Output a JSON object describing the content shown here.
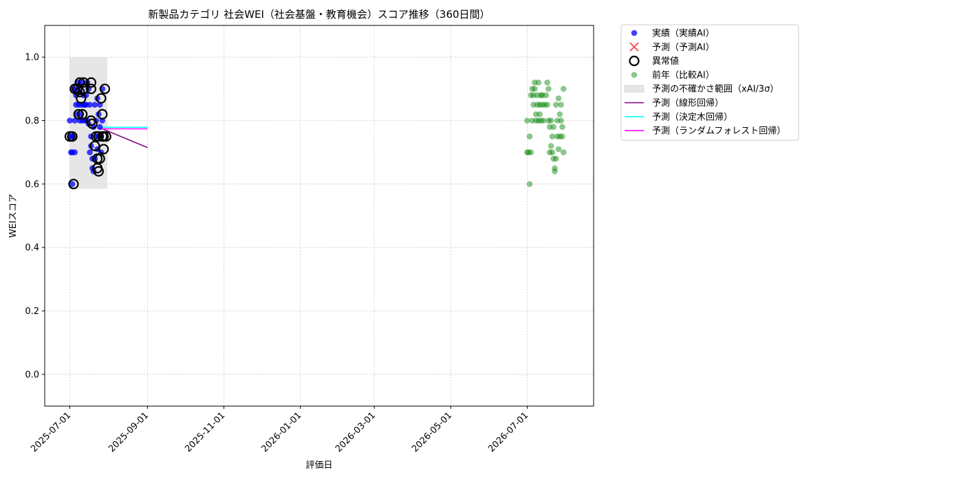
{
  "chart_data": {
    "type": "scatter",
    "title": "新製品カテゴリ 社会WEI（社会基盤・教育機会）スコア推移（360日間）",
    "xlabel": "評価日",
    "ylabel": "WEIスコア",
    "x_ticks": [
      "2025-07-01",
      "2025-09-01",
      "2025-11-01",
      "2026-01-01",
      "2026-03-01",
      "2026-05-01",
      "2026-07-01"
    ],
    "xlim": [
      "2025-06-11",
      "2026-08-23"
    ],
    "y_ticks": [
      "0.0",
      "0.2",
      "0.4",
      "0.6",
      "0.8",
      "1.0"
    ],
    "ylim": [
      -0.1,
      1.1
    ],
    "grid": true,
    "legend_placement": "outside-right-top",
    "colors": {
      "actual": "#0000ff",
      "forecast": "#ff0000",
      "anomaly": "#000000",
      "previous_year": "#008000",
      "uncertainty": "#e5e5e5",
      "linear": "#800080",
      "tree": "#00ffff",
      "forest": "#ff00ff"
    },
    "legend": [
      {
        "key": "actual",
        "label": "実績（実績AI）",
        "marker": "dot"
      },
      {
        "key": "forecast",
        "label": "予測（予測AI）",
        "marker": "cross"
      },
      {
        "key": "anomaly",
        "label": "異常値",
        "marker": "ring"
      },
      {
        "key": "previous_year",
        "label": "前年（比較AI）",
        "marker": "dot-faded"
      },
      {
        "key": "uncertainty",
        "label": "予測の不確かさ範囲（xAI/3σ）",
        "marker": "patch"
      },
      {
        "key": "linear",
        "label": "予測（線形回帰）",
        "marker": "line"
      },
      {
        "key": "tree",
        "label": "予測（決定木回帰）",
        "marker": "line"
      },
      {
        "key": "forest",
        "label": "予測（ランダムフォレスト回帰）",
        "marker": "line"
      }
    ],
    "uncertainty_band": {
      "x": [
        "2025-07-01",
        "2025-07-31"
      ],
      "y": [
        0.585,
        1.0
      ]
    },
    "series": [
      {
        "key": "actual",
        "type": "scatter",
        "points": [
          [
            "2025-07-01",
            0.8
          ],
          [
            "2025-07-01",
            0.75
          ],
          [
            "2025-07-02",
            0.7
          ],
          [
            "2025-07-02",
            0.75
          ],
          [
            "2025-07-03",
            0.6
          ],
          [
            "2025-07-03",
            0.7
          ],
          [
            "2025-07-04",
            0.75
          ],
          [
            "2025-07-04",
            0.9
          ],
          [
            "2025-07-05",
            0.7
          ],
          [
            "2025-07-05",
            0.8
          ],
          [
            "2025-07-06",
            0.85
          ],
          [
            "2025-07-06",
            0.88
          ],
          [
            "2025-07-07",
            0.9
          ],
          [
            "2025-07-07",
            0.82
          ],
          [
            "2025-07-08",
            0.85
          ],
          [
            "2025-07-08",
            0.92
          ],
          [
            "2025-07-09",
            0.8
          ],
          [
            "2025-07-09",
            0.89
          ],
          [
            "2025-07-10",
            0.85
          ],
          [
            "2025-07-10",
            0.82
          ],
          [
            "2025-07-11",
            0.8
          ],
          [
            "2025-07-11",
            0.92
          ],
          [
            "2025-07-12",
            0.85
          ],
          [
            "2025-07-12",
            0.88
          ],
          [
            "2025-07-13",
            0.8
          ],
          [
            "2025-07-13",
            0.85
          ],
          [
            "2025-07-14",
            0.88
          ],
          [
            "2025-07-14",
            0.85
          ],
          [
            "2025-07-15",
            0.92
          ],
          [
            "2025-07-15",
            0.8
          ],
          [
            "2025-07-16",
            0.79
          ],
          [
            "2025-07-16",
            0.9
          ],
          [
            "2025-07-17",
            0.85
          ],
          [
            "2025-07-17",
            0.7
          ],
          [
            "2025-07-18",
            0.72
          ],
          [
            "2025-07-18",
            0.75
          ],
          [
            "2025-07-19",
            0.68
          ],
          [
            "2025-07-19",
            0.65
          ],
          [
            "2025-07-20",
            0.78
          ],
          [
            "2025-07-20",
            0.64
          ],
          [
            "2025-07-21",
            0.68
          ],
          [
            "2025-07-21",
            0.85
          ],
          [
            "2025-07-22",
            0.75
          ],
          [
            "2025-07-22",
            0.8
          ],
          [
            "2025-07-23",
            0.87
          ],
          [
            "2025-07-23",
            0.71
          ],
          [
            "2025-07-24",
            0.82
          ],
          [
            "2025-07-24",
            0.75
          ],
          [
            "2025-07-25",
            0.85
          ],
          [
            "2025-07-25",
            0.78
          ],
          [
            "2025-07-26",
            0.75
          ],
          [
            "2025-07-26",
            0.7
          ],
          [
            "2025-07-27",
            0.8
          ],
          [
            "2025-07-27",
            0.9
          ]
        ]
      },
      {
        "key": "anomaly",
        "type": "scatter",
        "points": [
          [
            "2025-07-01",
            0.75
          ],
          [
            "2025-07-03",
            0.75
          ],
          [
            "2025-07-04",
            0.6
          ],
          [
            "2025-07-05",
            0.9
          ],
          [
            "2025-07-07",
            0.9
          ],
          [
            "2025-07-08",
            0.82
          ],
          [
            "2025-07-09",
            0.92
          ],
          [
            "2025-07-09",
            0.89
          ],
          [
            "2025-07-10",
            0.87
          ],
          [
            "2025-07-11",
            0.82
          ],
          [
            "2025-07-12",
            0.92
          ],
          [
            "2025-07-12",
            0.9
          ],
          [
            "2025-07-18",
            0.92
          ],
          [
            "2025-07-18",
            0.9
          ],
          [
            "2025-07-18",
            0.8
          ],
          [
            "2025-07-19",
            0.79
          ],
          [
            "2025-07-21",
            0.72
          ],
          [
            "2025-07-22",
            0.75
          ],
          [
            "2025-07-23",
            0.68
          ],
          [
            "2025-07-23",
            0.65
          ],
          [
            "2025-07-24",
            0.64
          ],
          [
            "2025-07-24",
            0.75
          ],
          [
            "2025-07-25",
            0.68
          ],
          [
            "2025-07-26",
            0.87
          ],
          [
            "2025-07-27",
            0.82
          ],
          [
            "2025-07-27",
            0.75
          ],
          [
            "2025-07-28",
            0.71
          ],
          [
            "2025-07-28",
            0.75
          ],
          [
            "2025-07-29",
            0.9
          ],
          [
            "2025-07-30",
            0.75
          ]
        ]
      },
      {
        "key": "previous_year",
        "type": "scatter",
        "points": [
          [
            "2026-07-01",
            0.8
          ],
          [
            "2026-07-01",
            0.7
          ],
          [
            "2026-07-02",
            0.7
          ],
          [
            "2026-07-03",
            0.75
          ],
          [
            "2026-07-03",
            0.6
          ],
          [
            "2026-07-04",
            0.88
          ],
          [
            "2026-07-04",
            0.7
          ],
          [
            "2026-07-05",
            0.9
          ],
          [
            "2026-07-05",
            0.8
          ],
          [
            "2026-07-06",
            0.85
          ],
          [
            "2026-07-06",
            0.88
          ],
          [
            "2026-07-07",
            0.9
          ],
          [
            "2026-07-07",
            0.92
          ],
          [
            "2026-07-08",
            0.82
          ],
          [
            "2026-07-08",
            0.8
          ],
          [
            "2026-07-09",
            0.88
          ],
          [
            "2026-07-09",
            0.85
          ],
          [
            "2026-07-10",
            0.92
          ],
          [
            "2026-07-10",
            0.8
          ],
          [
            "2026-07-11",
            0.82
          ],
          [
            "2026-07-11",
            0.85
          ],
          [
            "2026-07-12",
            0.88
          ],
          [
            "2026-07-12",
            0.8
          ],
          [
            "2026-07-13",
            0.85
          ],
          [
            "2026-07-13",
            0.88
          ],
          [
            "2026-07-14",
            0.8
          ],
          [
            "2026-07-15",
            0.85
          ],
          [
            "2026-07-16",
            0.88
          ],
          [
            "2026-07-17",
            0.92
          ],
          [
            "2026-07-17",
            0.85
          ],
          [
            "2026-07-18",
            0.8
          ],
          [
            "2026-07-18",
            0.9
          ],
          [
            "2026-07-19",
            0.7
          ],
          [
            "2026-07-19",
            0.78
          ],
          [
            "2026-07-20",
            0.72
          ],
          [
            "2026-07-20",
            0.8
          ],
          [
            "2026-07-21",
            0.75
          ],
          [
            "2026-07-21",
            0.7
          ],
          [
            "2026-07-22",
            0.68
          ],
          [
            "2026-07-22",
            0.78
          ],
          [
            "2026-07-23",
            0.65
          ],
          [
            "2026-07-23",
            0.64
          ],
          [
            "2026-07-24",
            0.85
          ],
          [
            "2026-07-24",
            0.68
          ],
          [
            "2026-07-25",
            0.75
          ],
          [
            "2026-07-25",
            0.8
          ],
          [
            "2026-07-26",
            0.87
          ],
          [
            "2026-07-26",
            0.71
          ],
          [
            "2026-07-27",
            0.82
          ],
          [
            "2026-07-27",
            0.75
          ],
          [
            "2026-07-28",
            0.8
          ],
          [
            "2026-07-28",
            0.85
          ],
          [
            "2026-07-29",
            0.78
          ],
          [
            "2026-07-29",
            0.75
          ],
          [
            "2026-07-30",
            0.9
          ],
          [
            "2026-07-30",
            0.7
          ]
        ]
      },
      {
        "key": "linear",
        "type": "line",
        "points": [
          [
            "2025-07-24",
            0.779
          ],
          [
            "2025-09-01",
            0.715
          ]
        ]
      },
      {
        "key": "tree",
        "type": "line",
        "points": [
          [
            "2025-07-24",
            0.779
          ],
          [
            "2025-09-01",
            0.779
          ]
        ]
      },
      {
        "key": "forest",
        "type": "line",
        "points": [
          [
            "2025-07-24",
            0.774
          ],
          [
            "2025-09-01",
            0.774
          ]
        ]
      }
    ]
  }
}
